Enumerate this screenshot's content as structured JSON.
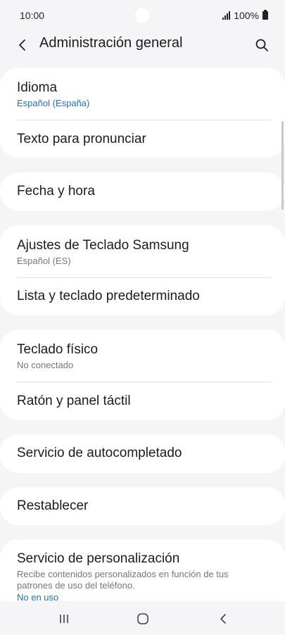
{
  "status_bar": {
    "time": "10:00",
    "battery": "100%",
    "icons": [
      "signal-icon",
      "battery-icon"
    ]
  },
  "header": {
    "title": "Administración general",
    "back_icon": "chevron-left-icon",
    "search_icon": "search-icon"
  },
  "groups": [
    {
      "items": [
        {
          "title": "Idioma",
          "subtitle": "Español (España)"
        },
        {
          "title": "Texto para pronunciar"
        }
      ]
    },
    {
      "items": [
        {
          "title": "Fecha y hora"
        }
      ]
    },
    {
      "items": [
        {
          "title": "Ajustes de Teclado Samsung",
          "subtitle": "Español (ES)"
        },
        {
          "title": "Lista y teclado predeterminado"
        }
      ]
    },
    {
      "items": [
        {
          "title": "Teclado físico",
          "subtitle": "No conectado"
        },
        {
          "title": "Ratón y panel táctil"
        }
      ]
    },
    {
      "items": [
        {
          "title": "Servicio de autocompletado"
        }
      ]
    },
    {
      "items": [
        {
          "title": "Restablecer"
        }
      ]
    },
    {
      "items": [
        {
          "title": "Servicio de personalización",
          "description": "Recibe contenidos personalizados en función de tus patrones de uso del teléfono.",
          "link": "No en uso"
        }
      ]
    }
  ],
  "colors": {
    "background": "#f5f5f7",
    "card": "#ffffff",
    "accent": "#1f6fd6",
    "secondary_text": "#777777"
  },
  "nav_bar": {
    "icons": [
      "recent-apps-icon",
      "home-icon",
      "back-nav-icon"
    ]
  }
}
